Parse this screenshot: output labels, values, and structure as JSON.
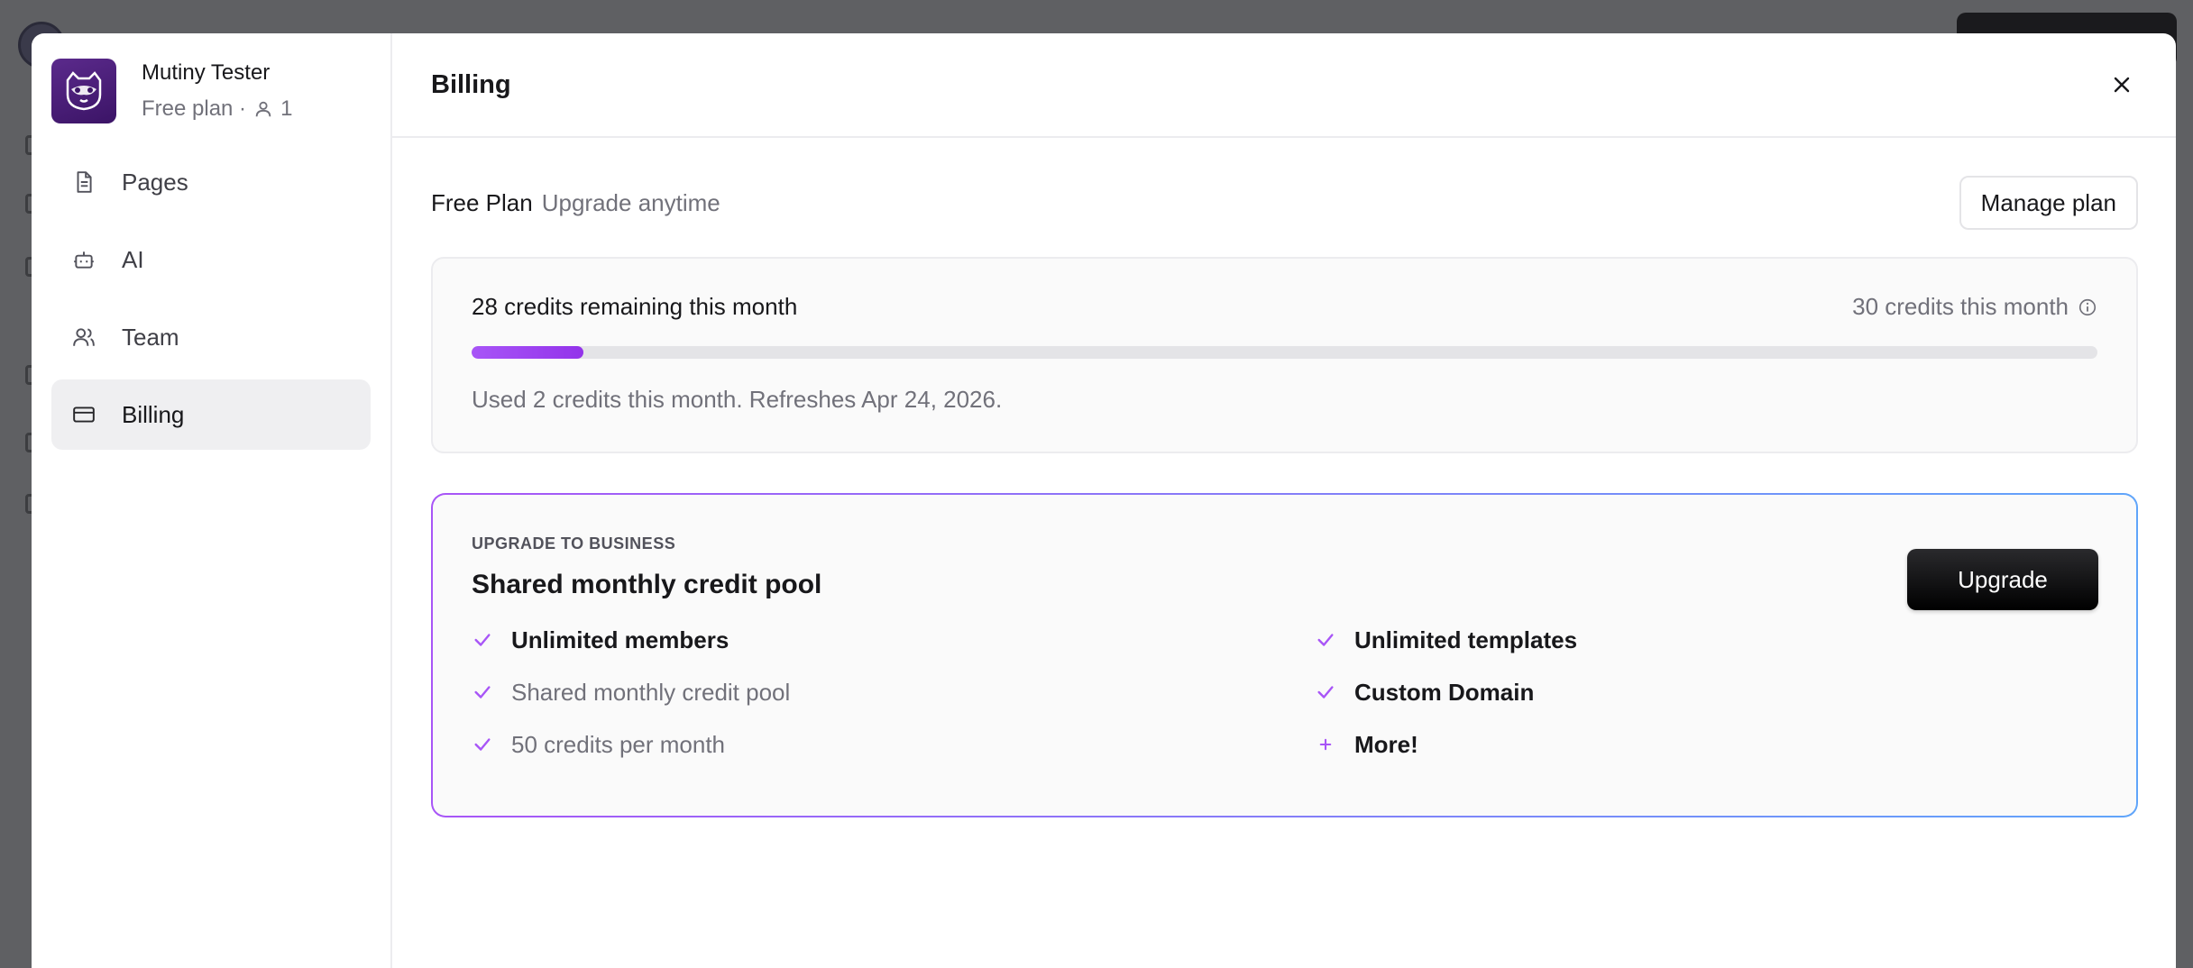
{
  "org": {
    "name": "Mutiny Tester",
    "plan_label": "Free plan ·",
    "member_count": "1"
  },
  "sidebar": {
    "items": [
      {
        "label": "Pages",
        "icon": "file-icon",
        "active": false
      },
      {
        "label": "AI",
        "icon": "bot-icon",
        "active": false
      },
      {
        "label": "Team",
        "icon": "users-icon",
        "active": false
      },
      {
        "label": "Billing",
        "icon": "credit-card-icon",
        "active": true
      }
    ]
  },
  "header": {
    "title": "Billing"
  },
  "plan": {
    "name": "Free Plan",
    "subtitle": "Upgrade anytime",
    "manage_label": "Manage plan"
  },
  "credits": {
    "remaining_text": "28 credits remaining this month",
    "total_text": "30 credits this month",
    "used": 2,
    "total": 30,
    "progress_fraction": 0.069,
    "note": "Used 2 credits this month. Refreshes Apr 24, 2026."
  },
  "upgrade": {
    "eyebrow": "UPGRADE TO BUSINESS",
    "title": "Shared monthly credit pool",
    "button_label": "Upgrade",
    "features_left": [
      {
        "label": "Unlimited members",
        "style": "bold",
        "icon": "check-icon"
      },
      {
        "label": "Shared monthly credit pool",
        "style": "muted",
        "icon": "check-icon"
      },
      {
        "label": "50 credits per month",
        "style": "muted",
        "icon": "check-icon"
      }
    ],
    "features_right": [
      {
        "label": "Unlimited templates",
        "style": "bold",
        "icon": "check-icon"
      },
      {
        "label": "Custom Domain",
        "style": "bold",
        "icon": "check-icon"
      },
      {
        "label": "More!",
        "style": "bold",
        "icon": "plus-icon"
      }
    ]
  },
  "colors": {
    "accent": "#a855f7",
    "gradient_end": "#60a5fa",
    "overlay": "#5f6063"
  }
}
